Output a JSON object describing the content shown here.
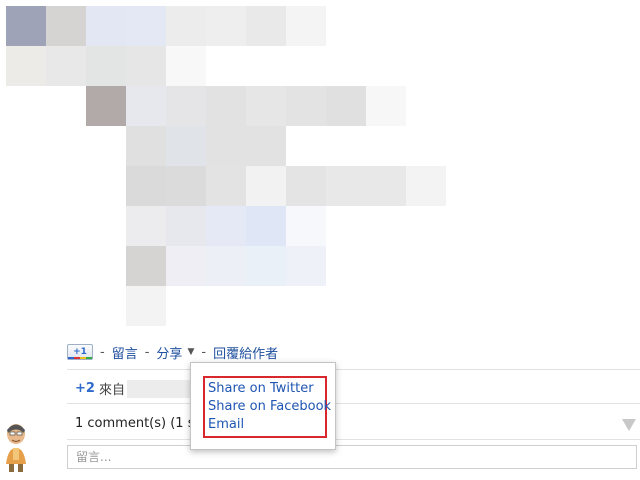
{
  "actions": {
    "plus1_label": "+1",
    "sep1": "-",
    "comment_link": "留言",
    "sep2": "-",
    "share_link": "分享",
    "sep3": "-",
    "reply_link": "回覆給作者"
  },
  "plus_row": {
    "count": "+2",
    "from_label": "來自"
  },
  "comments_row": {
    "text": "1 comment(s) (1 sh"
  },
  "comment_box": {
    "placeholder": "留言..."
  },
  "share_menu": {
    "items": [
      "Share on Twitter",
      "Share on Facebook",
      "Email"
    ]
  },
  "colors": {
    "link": "#1f4f9e",
    "highlight_border": "#d9272e",
    "plus_count": "#2f6bcc"
  }
}
